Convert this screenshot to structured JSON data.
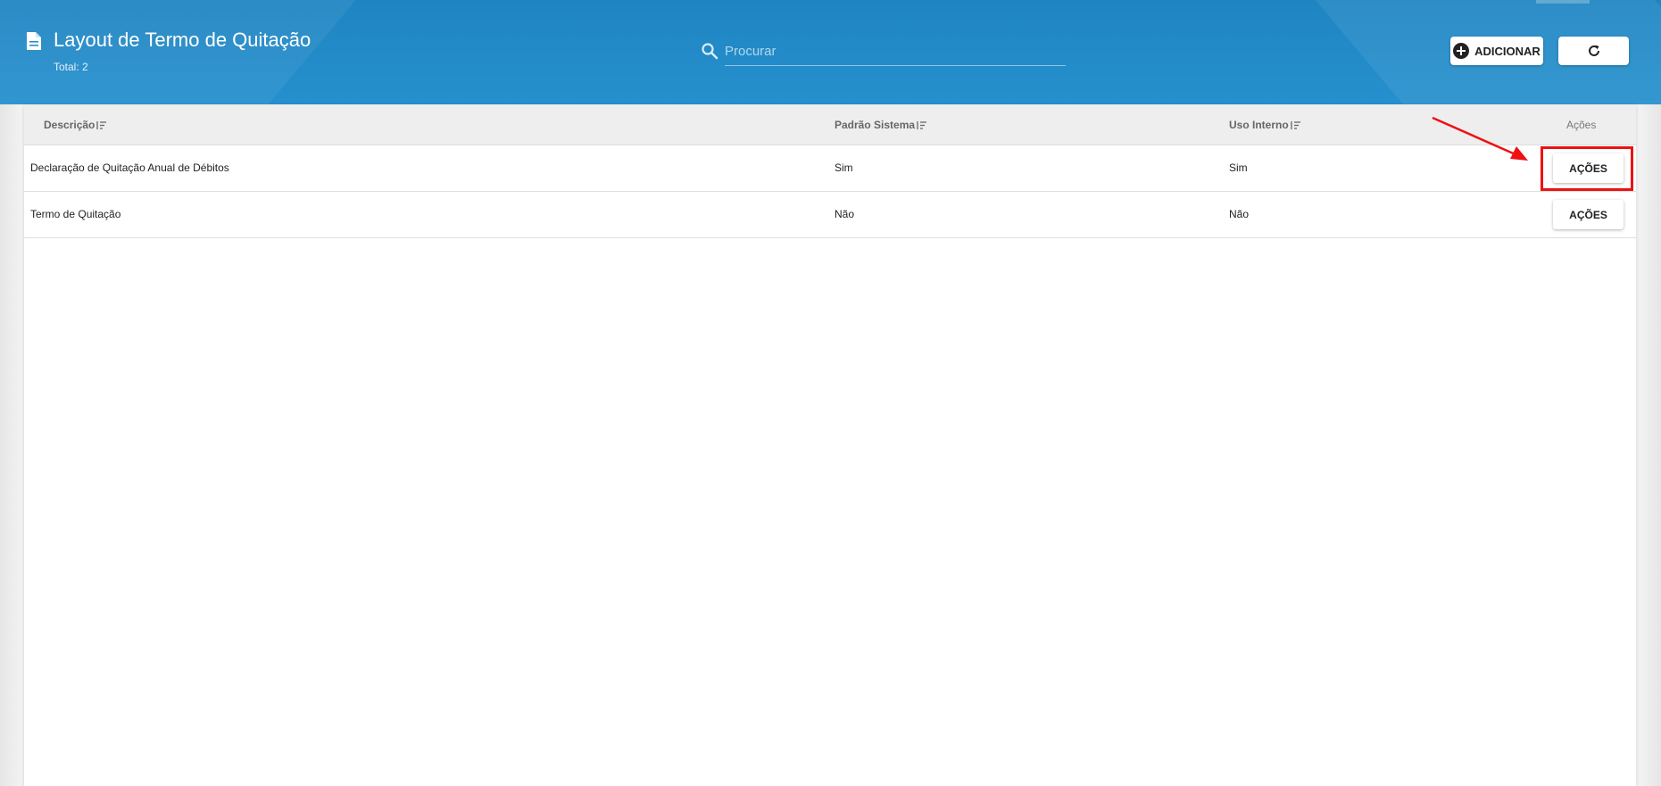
{
  "header": {
    "title": "Layout de Termo de Quitação",
    "total": "Total: 2",
    "search_placeholder": "Procurar",
    "search_value": "",
    "add_label": "ADICIONAR",
    "icons": [
      "document-icon",
      "search-icon",
      "plus-circle-icon",
      "refresh-icon"
    ]
  },
  "table": {
    "columns": [
      {
        "label": "Descrição",
        "sortable": true
      },
      {
        "label": "Padrão Sistema",
        "sortable": true
      },
      {
        "label": "Uso Interno",
        "sortable": true
      },
      {
        "label": "Ações",
        "sortable": false
      }
    ],
    "rows": [
      {
        "descricao": "Declaração de Quitação Anual de Débitos",
        "padrao_sistema": "Sim",
        "uso_interno": "Sim",
        "acoes_label": "AÇÕES"
      },
      {
        "descricao": "Termo de Quitação",
        "padrao_sistema": "Não",
        "uso_interno": "Não",
        "acoes_label": "AÇÕES"
      }
    ]
  },
  "annotation": {
    "highlight_color": "#ee1111",
    "target": "first-row-acoes-button"
  },
  "colors": {
    "header_blue": "#2590cd",
    "table_header_bg": "#eeeeee"
  }
}
